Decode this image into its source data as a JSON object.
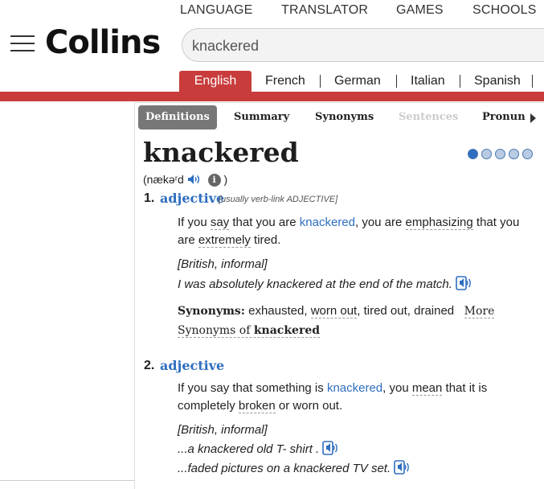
{
  "topnav": [
    "LANGUAGE",
    "TRANSLATOR",
    "GAMES",
    "SCHOOLS"
  ],
  "logo": "Collins",
  "search": {
    "value": "knackered"
  },
  "languages": [
    "English",
    "French",
    "German",
    "Italian",
    "Spanish"
  ],
  "subtabs": [
    "Definitions",
    "Summary",
    "Synonyms",
    "Sentences",
    "Pronun"
  ],
  "entry": {
    "headword": "knackered",
    "frequency_level": 1,
    "frequency_max": 5,
    "pron_open": "(",
    "pronunciation": "næ​kəʳd",
    "pron_close": ")",
    "sense1": {
      "num": "1.",
      "pos": "adjective",
      "grammar": "[usually verb-link ADJECTIVE]",
      "def_a": "If you ",
      "def_say": "say",
      "def_b": " that you are ",
      "def_kw": "knackered",
      "def_c": ", you are ",
      "def_emph": "emphasizing",
      "def_d": " that you are ",
      "def_extr": "extremely",
      "def_e": " tired.",
      "register": "[British, informal]",
      "example": "I was absolutely knackered at the end of the match.",
      "syn_label": "Synonyms:",
      "syn_1": " exhausted, ",
      "syn_worn": "worn out",
      "syn_2": ", tired out, drained",
      "more_label": "More Synonyms of",
      "more_word": "knackered"
    },
    "sense2": {
      "num": "2.",
      "pos": "adjective",
      "def_a": "If you say that something is ",
      "def_kw": "knackered",
      "def_b": ", you ",
      "def_mean": "mean",
      "def_c": " that it is completely ",
      "def_broken": "broken",
      "def_d": " or worn out.",
      "register": "[British, informal]",
      "example1": "...a knackered old T- shirt .",
      "example2": "...faded pictures on a knackered TV set."
    }
  },
  "colors": {
    "brand_red": "#c93c3c",
    "link_blue": "#2f6ec0",
    "tab_active": "#777777"
  }
}
